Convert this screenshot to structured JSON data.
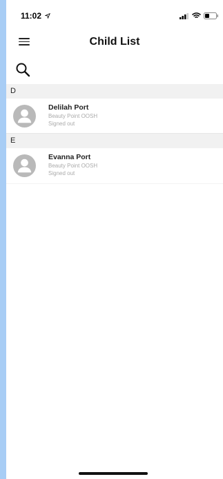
{
  "status": {
    "time": "11:02"
  },
  "header": {
    "title": "Child List"
  },
  "sections": [
    {
      "letter": "D",
      "children": [
        {
          "name": "Delilah Port",
          "school": "Beauty Point OOSH",
          "status": "Signed out"
        }
      ]
    },
    {
      "letter": "E",
      "children": [
        {
          "name": "Evanna Port",
          "school": "Beauty Point OOSH",
          "status": "Signed out"
        }
      ]
    }
  ]
}
